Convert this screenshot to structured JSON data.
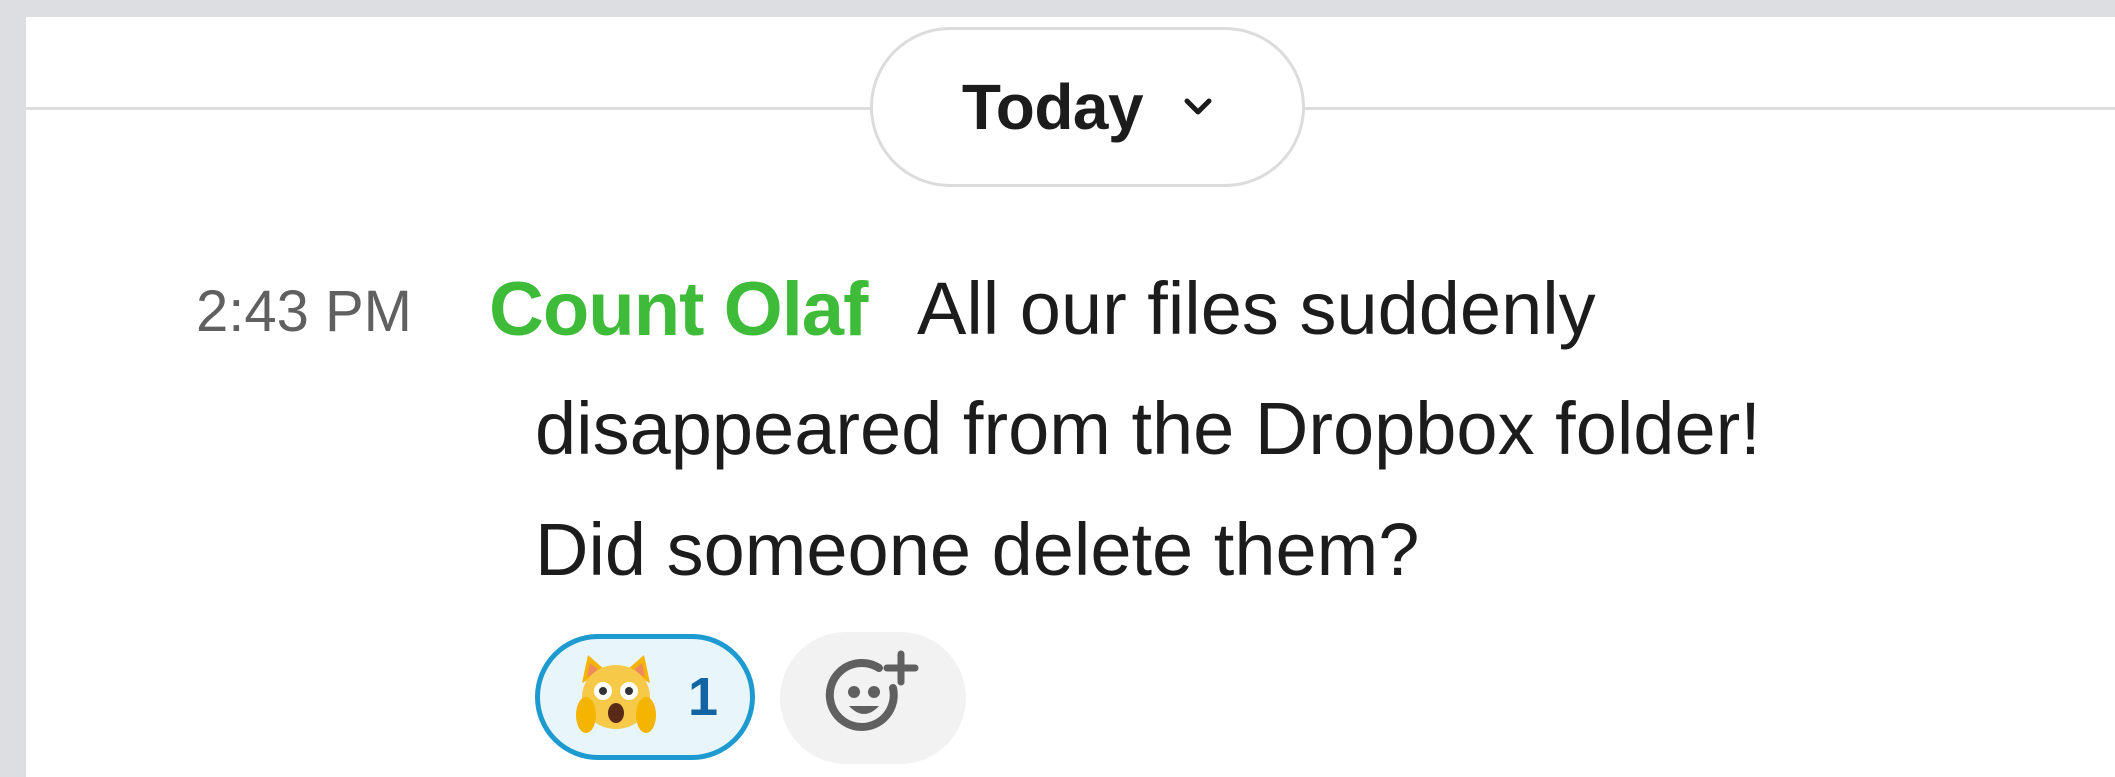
{
  "divider": {
    "label": "Today",
    "dropdown_icon": "chevron-down-icon"
  },
  "message": {
    "timestamp": "2:43 PM",
    "author": "Count Olaf",
    "author_color": "#3fbb3a",
    "text_lines": [
      "All our files suddenly",
      "disappeared from the Dropbox folder!",
      "Did someone delete them?"
    ],
    "reactions": [
      {
        "emoji": "scream-cat-icon",
        "count": "1"
      }
    ],
    "add_reaction_icon": "add-reaction-icon"
  }
}
